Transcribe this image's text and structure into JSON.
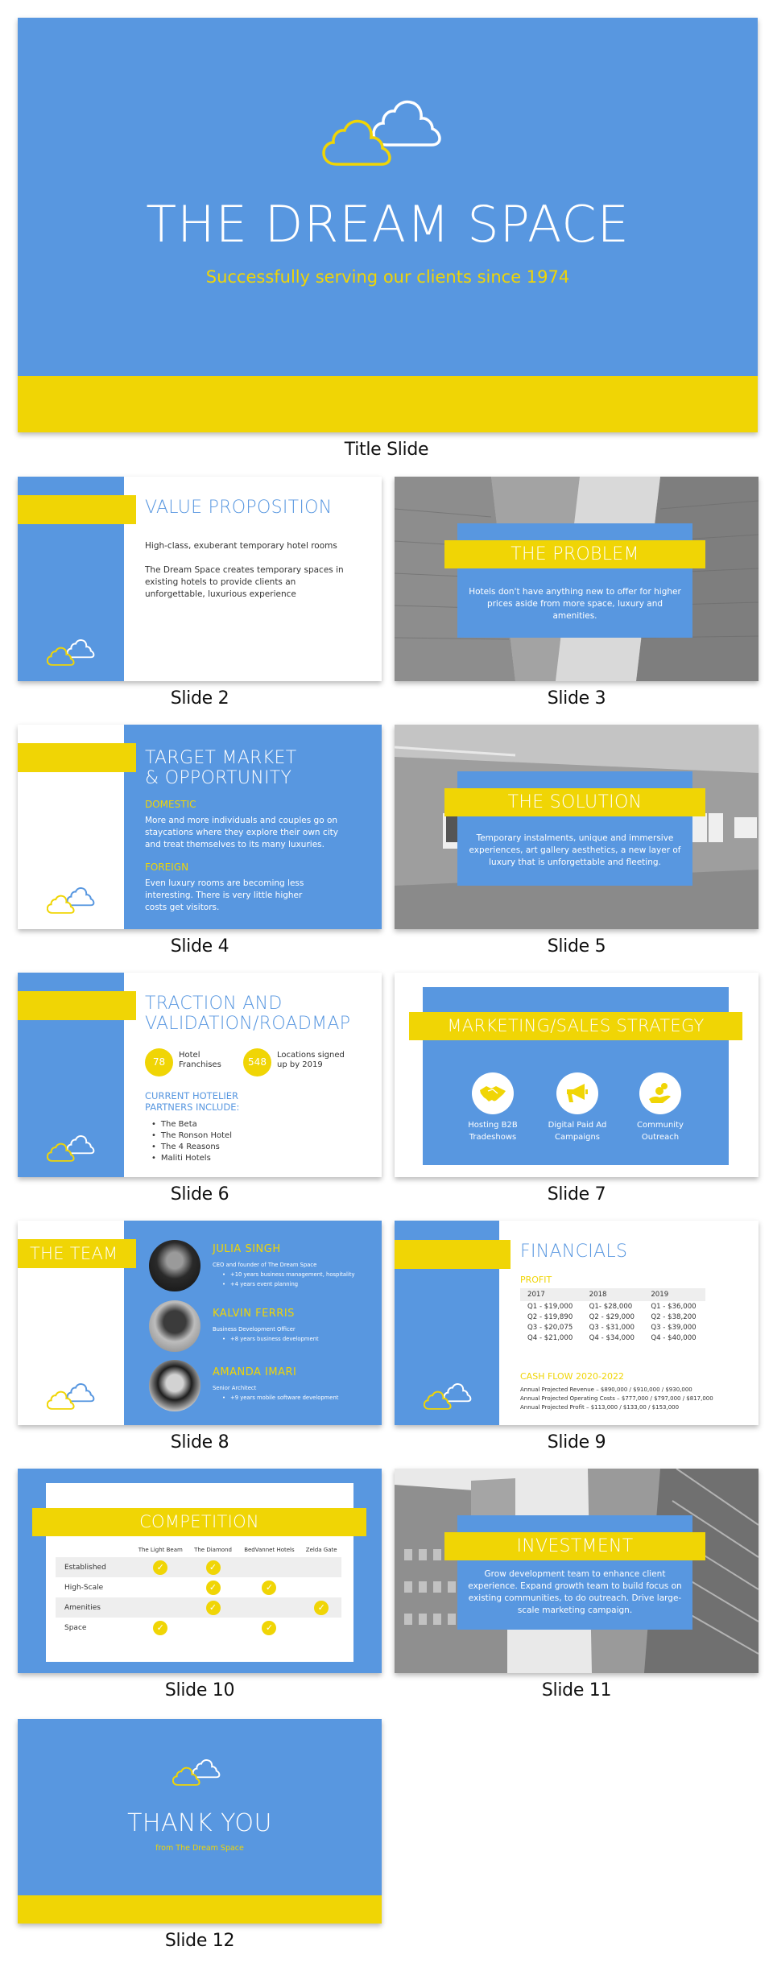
{
  "colors": {
    "blue": "#5897e0",
    "yellow": "#f0d505",
    "white": "#ffffff",
    "text_dark": "#333333"
  },
  "title_slide": {
    "title": "THE DREAM SPACE",
    "subtitle": "Successfully serving our clients since 1974",
    "caption": "Title Slide",
    "icon": "cloud-logo-icon"
  },
  "slides": {
    "s2": {
      "caption": "Slide 2",
      "heading": "VALUE PROPOSITION",
      "line1": "High-class, exuberant temporary hotel rooms",
      "line2": "The Dream Space creates temporary spaces in existing hotels to provide clients an unforgettable, luxurious experience"
    },
    "s3": {
      "caption": "Slide 3",
      "heading": "THE PROBLEM",
      "text": "Hotels don't have anything new to offer for higher prices aside from more space, luxury and amenities.",
      "background": "skyscrapers-photo"
    },
    "s4": {
      "caption": "Slide 4",
      "heading_line1": "TARGET MARKET",
      "heading_line2": "& OPPORTUNITY",
      "domestic_label": "DOMESTIC",
      "domestic_text": "More and more individuals and couples go on staycations where they explore their own city and treat themselves to its many luxuries.",
      "foreign_label": "FOREIGN",
      "foreign_text": "Even luxury rooms are becoming less interesting. There is very little higher costs get visitors."
    },
    "s5": {
      "caption": "Slide 5",
      "heading": "THE SOLUTION",
      "text": "Temporary instalments, unique and immersive experiences, art gallery aesthetics, a new layer of luxury that is unforgettable and fleeting.",
      "background": "art-gallery-photo"
    },
    "s6": {
      "caption": "Slide 6",
      "heading_line1": "TRACTION AND",
      "heading_line2": "VALIDATION/ROADMAP",
      "stats": [
        {
          "value": "78",
          "label_line1": "Hotel",
          "label_line2": "Franchises"
        },
        {
          "value": "548",
          "label_line1": "Locations signed",
          "label_line2": "up by 2019"
        }
      ],
      "partners_heading_line1": "CURRENT HOTELIER",
      "partners_heading_line2": "PARTNERS INCLUDE:",
      "partners": [
        "The Beta",
        "The Ronson Hotel",
        "The 4 Reasons",
        "Maliti Hotels"
      ]
    },
    "s7": {
      "caption": "Slide 7",
      "heading": "MARKETING/SALES STRATEGY",
      "items": [
        {
          "icon": "handshake-icon",
          "line1": "Hosting B2B",
          "line2": "Tradeshows"
        },
        {
          "icon": "megaphone-icon",
          "line1": "Digital Paid Ad",
          "line2": "Campaigns"
        },
        {
          "icon": "coin-hand-icon",
          "line1": "Community",
          "line2": "Outreach"
        }
      ]
    },
    "s8": {
      "caption": "Slide 8",
      "heading": "THE TEAM",
      "members": [
        {
          "name": "JULIA SINGH",
          "role": "CEO and founder of The Dream Space",
          "bullets": [
            "+10 years business management, hospitality",
            "+4 years event planning"
          ]
        },
        {
          "name": "KALVIN FERRIS",
          "role": "Business Development Officer",
          "bullets": [
            "+8 years business development"
          ]
        },
        {
          "name": "AMANDA IMARI",
          "role": "Senior Architect",
          "bullets": [
            "+9 years mobile software development"
          ]
        }
      ]
    },
    "s9": {
      "caption": "Slide 9",
      "heading": "FINANCIALS",
      "profit_label": "PROFIT",
      "profit_table": {
        "headers": [
          "2017",
          "2018",
          "2019"
        ],
        "rows": [
          [
            "Q1 - $19,000",
            "Q1- $28,000",
            "Q1 - $36,000"
          ],
          [
            "Q2 - $19,890",
            "Q2 - $29,000",
            "Q2 - $38,200"
          ],
          [
            "Q3 - $20,075",
            "Q3 - $31,000",
            "Q3 - $39,000"
          ],
          [
            "Q4 - $21,000",
            "Q4 - $34,000",
            "Q4 - $40,000"
          ]
        ]
      },
      "cashflow_label": "CASH FLOW 2020-2022",
      "cashflow_lines": [
        "Annual Projected Revenue – $890,000 / $910,000 / $930,000",
        "Annual Projected Operating Costs – $777,000 / $797,000 / $817,000",
        "Annual Projected Profit – $113,000 / $133,00 / $153,000"
      ]
    },
    "s10": {
      "caption": "Slide 10",
      "heading": "COMPETITION",
      "columns": [
        "The Light Beam",
        "The Diamond",
        "BedVannet Hotels",
        "Zelda Gate"
      ],
      "rows": [
        {
          "label": "Established",
          "checks": [
            true,
            true,
            false,
            false
          ]
        },
        {
          "label": "High-Scale",
          "checks": [
            false,
            true,
            true,
            false
          ]
        },
        {
          "label": "Amenities",
          "checks": [
            false,
            true,
            false,
            true
          ]
        },
        {
          "label": "Space",
          "checks": [
            true,
            false,
            true,
            false
          ]
        }
      ],
      "check_glyph": "✓"
    },
    "s11": {
      "caption": "Slide 11",
      "heading": "INVESTMENT",
      "text": "Grow development team to enhance client experience. Expand growth team to build focus on existing communities, to do outreach. Drive large-scale marketing campaign.",
      "background": "city-buildings-photo"
    },
    "s12": {
      "caption": "Slide 12",
      "heading": "THANK YOU",
      "subtitle": "from The Dream Space"
    }
  }
}
